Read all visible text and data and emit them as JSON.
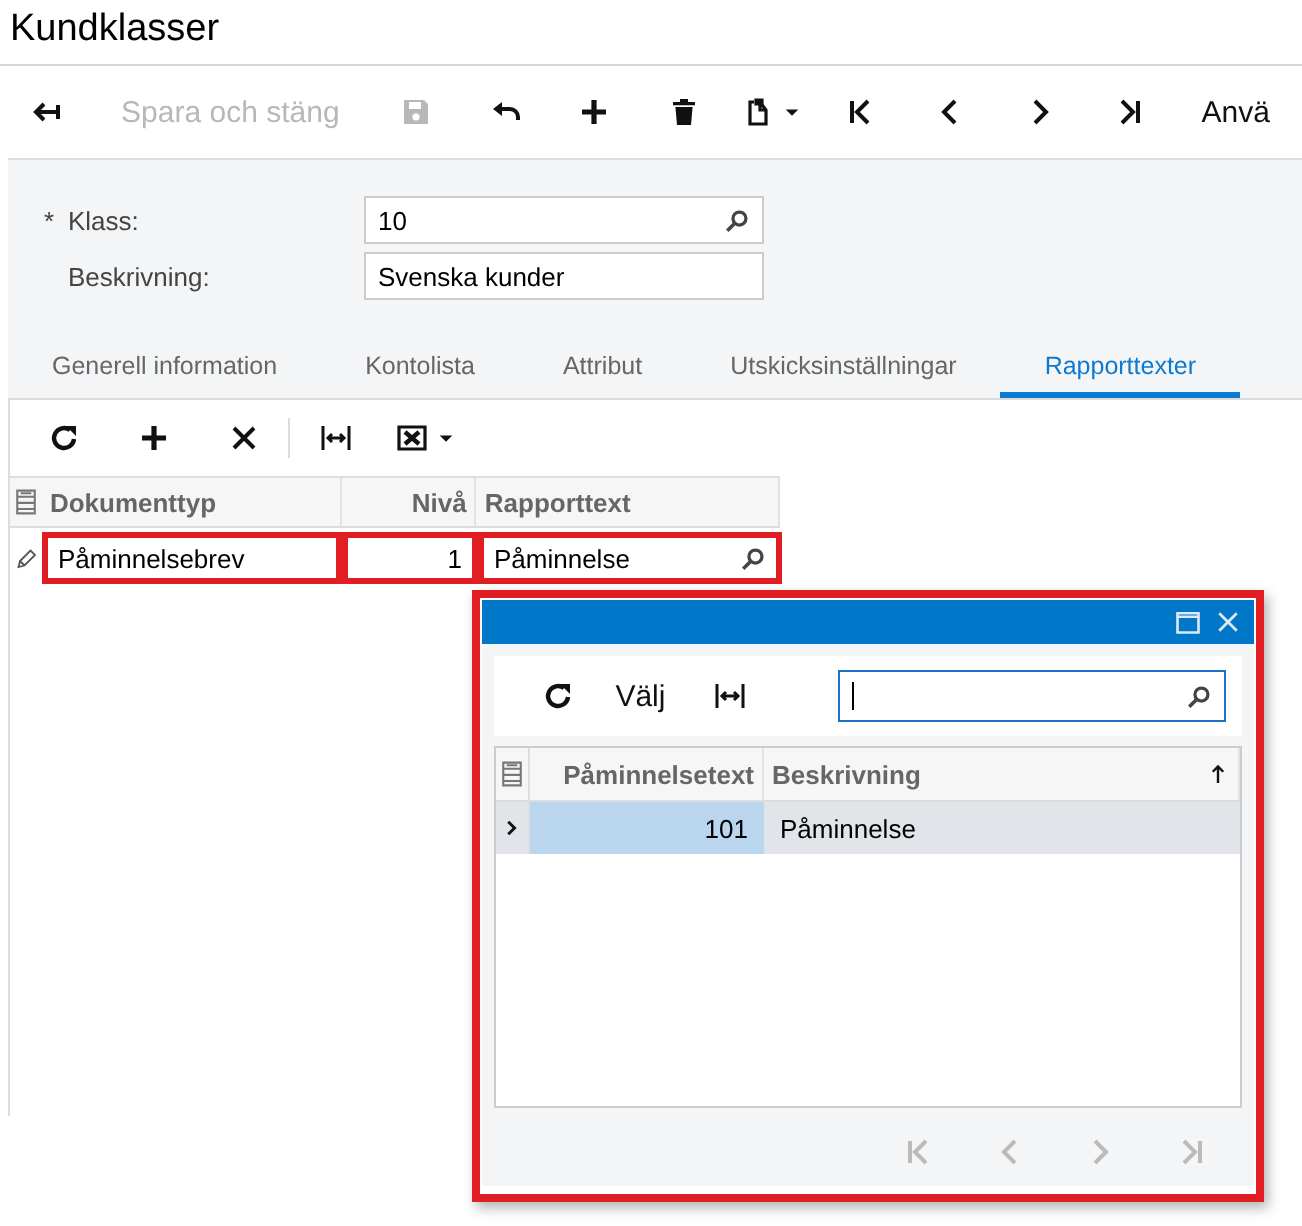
{
  "page_title": "Kundklasser",
  "toolbar": [
    {
      "kind": "back",
      "disabled": false
    },
    {
      "kind": "text",
      "label": "Spara och stäng",
      "disabled": true
    },
    {
      "kind": "save",
      "disabled": true
    },
    {
      "kind": "undo",
      "disabled": false
    },
    {
      "kind": "add",
      "disabled": false
    },
    {
      "kind": "trash",
      "disabled": false
    },
    {
      "kind": "clipboard",
      "disabled": false
    },
    {
      "kind": "first",
      "disabled": false
    },
    {
      "kind": "prev",
      "disabled": false
    },
    {
      "kind": "next",
      "disabled": false
    },
    {
      "kind": "last",
      "disabled": false
    },
    {
      "kind": "text",
      "label": "Anvä",
      "disabled": false
    }
  ],
  "form": {
    "fields": [
      {
        "label": "Klass:",
        "required_mark": "*",
        "value": "10",
        "lookup": true
      },
      {
        "label": "Beskrivning:",
        "value": "Svenska kunder",
        "lookup": false
      }
    ]
  },
  "tabs": [
    {
      "label": "Generell information",
      "selected": false
    },
    {
      "label": "Kontolista",
      "selected": false
    },
    {
      "label": "Attribut",
      "selected": false
    },
    {
      "label": "Utskicksinställningar",
      "selected": false
    },
    {
      "label": "Rapporttexter",
      "selected": true
    }
  ],
  "grid_toolbar": [
    {
      "kind": "refresh"
    },
    {
      "kind": "add"
    },
    {
      "kind": "delete"
    },
    {
      "kind": "fit"
    },
    {
      "kind": "excel"
    }
  ],
  "grid": {
    "columns": [
      {
        "label": "Dokumenttyp",
        "kind": "text"
      },
      {
        "label": "Nivå",
        "kind": "number"
      },
      {
        "label": "Rapporttext",
        "kind": "lookup"
      }
    ],
    "rows": [
      {
        "editing": true,
        "cells": [
          {
            "text": "Påminnelsebrev",
            "highlighted": true
          },
          {
            "text": "1",
            "highlighted": true
          },
          {
            "text": "Påminnelse",
            "highlighted": true
          }
        ]
      }
    ]
  },
  "popup": {
    "highlighted": true,
    "toolbar": [
      {
        "kind": "refresh"
      },
      {
        "kind": "text",
        "label": "Välj"
      },
      {
        "kind": "fit"
      }
    ],
    "grid": {
      "columns": [
        {
          "label": "Påminnelsetext",
          "kind": "number",
          "sorted": false
        },
        {
          "label": "Beskrivning",
          "kind": "text",
          "sorted": true
        }
      ],
      "rows": [
        {
          "selected": true,
          "cells": [
            "101",
            "Påminnelse"
          ]
        }
      ]
    },
    "pager": [
      {
        "kind": "first",
        "disabled": true
      },
      {
        "kind": "prev",
        "disabled": true
      },
      {
        "kind": "next",
        "disabled": true
      },
      {
        "kind": "last",
        "disabled": true
      }
    ]
  }
}
